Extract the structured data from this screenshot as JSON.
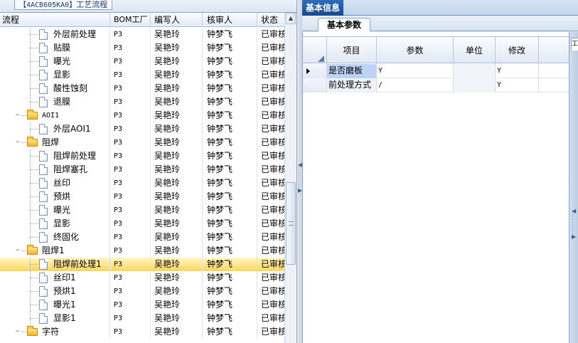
{
  "left_panel": {
    "tab_label_code": "【4ACB605KA0】",
    "tab_label_text": "工艺流程",
    "columns": {
      "name": "流程",
      "bom": "BOM工厂",
      "writer": "编写人",
      "reviewer": "核审人",
      "status": "状态"
    },
    "rows": [
      {
        "type": "item",
        "level": 2,
        "name": "外层前处理",
        "bom": "P3",
        "writer": "吴艳玲",
        "reviewer": "钟梦飞",
        "status": "已审核"
      },
      {
        "type": "item",
        "level": 2,
        "name": "贴膜",
        "bom": "P3",
        "writer": "吴艳玲",
        "reviewer": "钟梦飞",
        "status": "已审核"
      },
      {
        "type": "item",
        "level": 2,
        "name": "曝光",
        "bom": "P3",
        "writer": "吴艳玲",
        "reviewer": "钟梦飞",
        "status": "已审核"
      },
      {
        "type": "item",
        "level": 2,
        "name": "显影",
        "bom": "P3",
        "writer": "吴艳玲",
        "reviewer": "钟梦飞",
        "status": "已审核"
      },
      {
        "type": "item",
        "level": 2,
        "name": "酸性蚀刻",
        "bom": "P3",
        "writer": "吴艳玲",
        "reviewer": "钟梦飞",
        "status": "已审核"
      },
      {
        "type": "item",
        "level": 2,
        "name": "退膜",
        "bom": "P3",
        "writer": "吴艳玲",
        "reviewer": "钟梦飞",
        "status": "已审核"
      },
      {
        "type": "folder",
        "level": 1,
        "name": "AOI1",
        "bom": "P3",
        "writer": "吴艳玲",
        "reviewer": "钟梦飞",
        "status": "已审核"
      },
      {
        "type": "item",
        "level": 2,
        "name": "外层AOI1",
        "bom": "P3",
        "writer": "吴艳玲",
        "reviewer": "钟梦飞",
        "status": "已审核"
      },
      {
        "type": "folder",
        "level": 1,
        "name": "阻焊",
        "bom": "P3",
        "writer": "吴艳玲",
        "reviewer": "钟梦飞",
        "status": "已审核"
      },
      {
        "type": "item",
        "level": 2,
        "name": "阻焊前处理",
        "bom": "P3",
        "writer": "吴艳玲",
        "reviewer": "钟梦飞",
        "status": "已审核"
      },
      {
        "type": "item",
        "level": 2,
        "name": "阻焊塞孔",
        "bom": "P3",
        "writer": "吴艳玲",
        "reviewer": "钟梦飞",
        "status": "已审核"
      },
      {
        "type": "item",
        "level": 2,
        "name": "丝印",
        "bom": "P3",
        "writer": "吴艳玲",
        "reviewer": "钟梦飞",
        "status": "已审核"
      },
      {
        "type": "item",
        "level": 2,
        "name": "预烘",
        "bom": "P3",
        "writer": "吴艳玲",
        "reviewer": "钟梦飞",
        "status": "已审核"
      },
      {
        "type": "item",
        "level": 2,
        "name": "曝光",
        "bom": "P3",
        "writer": "吴艳玲",
        "reviewer": "钟梦飞",
        "status": "已审核"
      },
      {
        "type": "item",
        "level": 2,
        "name": "显影",
        "bom": "P3",
        "writer": "吴艳玲",
        "reviewer": "钟梦飞",
        "status": "已审核"
      },
      {
        "type": "item",
        "level": 2,
        "name": "终固化",
        "bom": "P3",
        "writer": "吴艳玲",
        "reviewer": "钟梦飞",
        "status": "已审核"
      },
      {
        "type": "folder",
        "level": 1,
        "name": "阻焊1",
        "bom": "P3",
        "writer": "吴艳玲",
        "reviewer": "钟梦飞",
        "status": "已审核"
      },
      {
        "type": "item",
        "level": 2,
        "name": "阻焊前处理1",
        "bom": "P3",
        "writer": "吴艳玲",
        "reviewer": "钟梦飞",
        "status": "已审核",
        "selected": true
      },
      {
        "type": "item",
        "level": 2,
        "name": "丝印1",
        "bom": "P3",
        "writer": "吴艳玲",
        "reviewer": "钟梦飞",
        "status": "已审核"
      },
      {
        "type": "item",
        "level": 2,
        "name": "预烘1",
        "bom": "P3",
        "writer": "吴艳玲",
        "reviewer": "钟梦飞",
        "status": "已审核"
      },
      {
        "type": "item",
        "level": 2,
        "name": "曝光1",
        "bom": "P3",
        "writer": "吴艳玲",
        "reviewer": "钟梦飞",
        "status": "已审核"
      },
      {
        "type": "item",
        "level": 2,
        "name": "显影1",
        "bom": "P3",
        "writer": "吴艳玲",
        "reviewer": "钟梦飞",
        "status": "已审核"
      },
      {
        "type": "folder",
        "level": 1,
        "name": "字符",
        "bom": "P3",
        "writer": "吴艳玲",
        "reviewer": "钟梦飞",
        "status": "已审核"
      }
    ]
  },
  "right_panel": {
    "tab_label": "基本信息",
    "subtab_label": "基本参数",
    "columns": {
      "item": "项目",
      "param": "参数",
      "unit": "单位",
      "modify": "修改"
    },
    "rows": [
      {
        "item": "是否磨板",
        "param": "Y",
        "unit": "",
        "modify": "Y",
        "current": true
      },
      {
        "item": "前处理方式",
        "param": "/",
        "unit": "",
        "modify": "Y"
      }
    ]
  },
  "colors": {
    "selected_row": "#ffd55a",
    "tab_active": "#18498f",
    "focus_cell": "#bcd3f4"
  }
}
